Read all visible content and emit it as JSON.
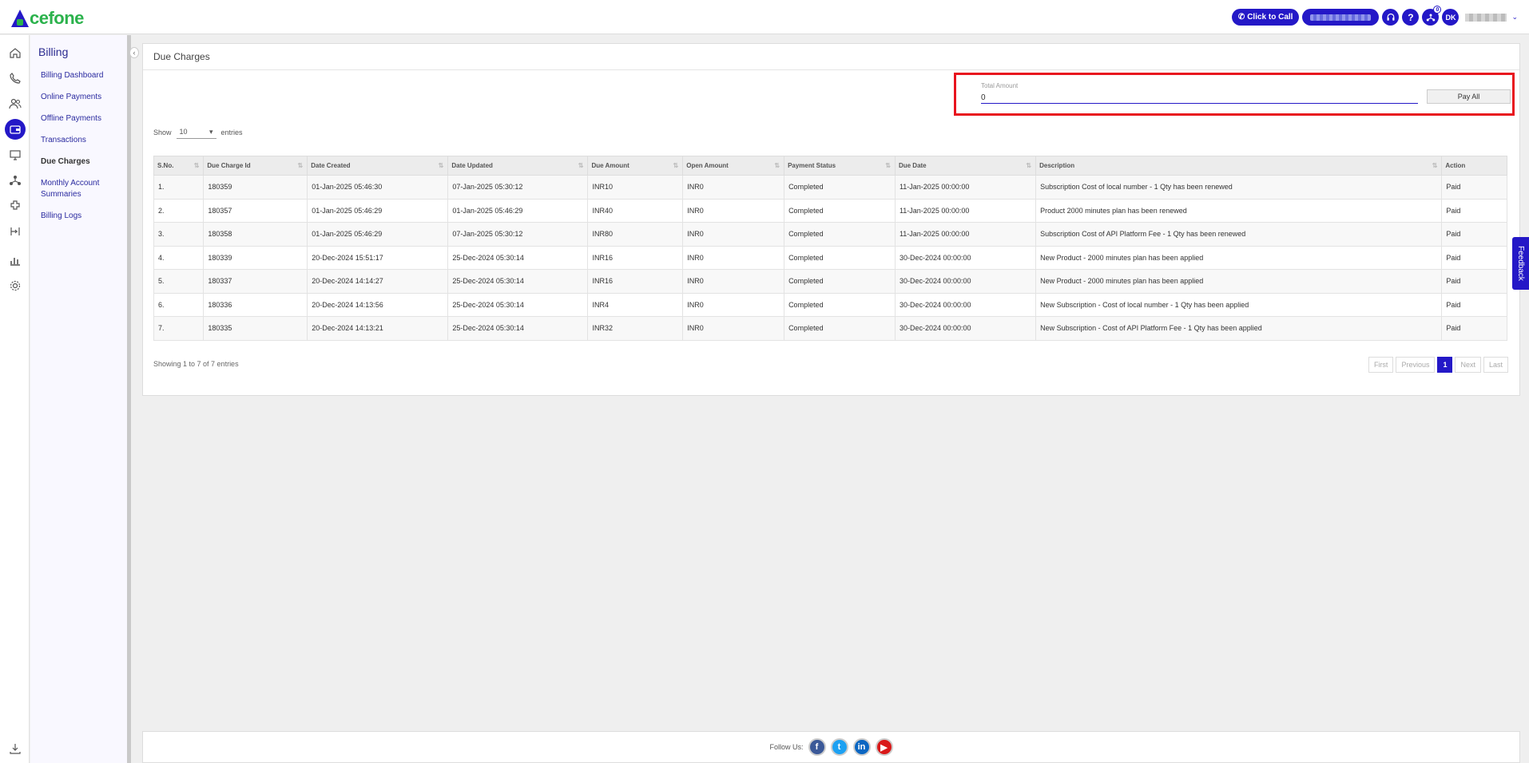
{
  "header": {
    "logo_text": "cefone",
    "click_to_call": "Click to Call",
    "help_glyph": "?",
    "notification_count": "0",
    "avatar_initials": "DK"
  },
  "rail": [
    "home-icon",
    "phone-icon",
    "users-icon",
    "wallet-icon",
    "monitor-icon",
    "network-icon",
    "plugin-icon",
    "routing-icon",
    "chart-icon",
    "gear-icon",
    "download-icon"
  ],
  "sidebar": {
    "title": "Billing",
    "items": [
      {
        "label": "Billing Dashboard"
      },
      {
        "label": "Online Payments"
      },
      {
        "label": "Offline Payments"
      },
      {
        "label": "Transactions"
      },
      {
        "label": "Due Charges"
      },
      {
        "label": "Monthly Account Summaries"
      },
      {
        "label": "Billing Logs"
      }
    ]
  },
  "page": {
    "title": "Due Charges",
    "total_label": "Total Amount",
    "total_value": "0",
    "pay_all": "Pay All",
    "show_label": "Show",
    "entries_value": "10",
    "entries_label": "entries",
    "showing_text": "Showing 1 to 7 of 7 entries"
  },
  "table": {
    "headers": [
      "S.No.",
      "Due Charge Id",
      "Date Created",
      "Date Updated",
      "Due Amount",
      "Open Amount",
      "Payment Status",
      "Due Date",
      "Description",
      "Action"
    ],
    "rows": [
      [
        "1.",
        "180359",
        "01-Jan-2025 05:46:30",
        "07-Jan-2025 05:30:12",
        "INR10",
        "INR0",
        "Completed",
        "11-Jan-2025 00:00:00",
        "Subscription Cost of local number - 1 Qty has been renewed",
        "Paid"
      ],
      [
        "2.",
        "180357",
        "01-Jan-2025 05:46:29",
        "01-Jan-2025 05:46:29",
        "INR40",
        "INR0",
        "Completed",
        "11-Jan-2025 00:00:00",
        "Product 2000 minutes plan has been renewed",
        "Paid"
      ],
      [
        "3.",
        "180358",
        "01-Jan-2025 05:46:29",
        "07-Jan-2025 05:30:12",
        "INR80",
        "INR0",
        "Completed",
        "11-Jan-2025 00:00:00",
        "Subscription Cost of API Platform Fee - 1 Qty has been renewed",
        "Paid"
      ],
      [
        "4.",
        "180339",
        "20-Dec-2024 15:51:17",
        "25-Dec-2024 05:30:14",
        "INR16",
        "INR0",
        "Completed",
        "30-Dec-2024 00:00:00",
        "New Product - 2000 minutes plan has been applied",
        "Paid"
      ],
      [
        "5.",
        "180337",
        "20-Dec-2024 14:14:27",
        "25-Dec-2024 05:30:14",
        "INR16",
        "INR0",
        "Completed",
        "30-Dec-2024 00:00:00",
        "New Product - 2000 minutes plan has been applied",
        "Paid"
      ],
      [
        "6.",
        "180336",
        "20-Dec-2024 14:13:56",
        "25-Dec-2024 05:30:14",
        "INR4",
        "INR0",
        "Completed",
        "30-Dec-2024 00:00:00",
        "New Subscription - Cost of local number - 1 Qty has been applied",
        "Paid"
      ],
      [
        "7.",
        "180335",
        "20-Dec-2024 14:13:21",
        "25-Dec-2024 05:30:14",
        "INR32",
        "INR0",
        "Completed",
        "30-Dec-2024 00:00:00",
        "New Subscription - Cost of API Platform Fee - 1 Qty has been applied",
        "Paid"
      ]
    ]
  },
  "pagination": {
    "first": "First",
    "previous": "Previous",
    "current": "1",
    "next": "Next",
    "last": "Last"
  },
  "feedback": "Feedback",
  "footer": {
    "follow": "Follow Us:",
    "facebook": "f",
    "twitter": "t",
    "linkedin": "in",
    "youtube": "▶"
  },
  "colors": {
    "brand": "#2418c7",
    "logo_green": "#2bb24c",
    "highlight": "#e8141e"
  }
}
